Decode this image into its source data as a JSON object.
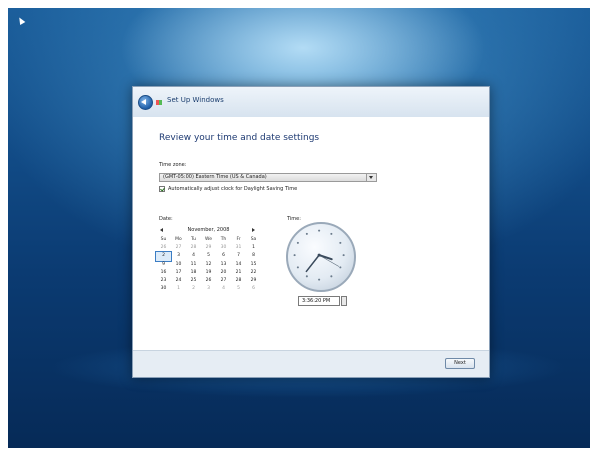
{
  "window": {
    "title": "Set Up Windows"
  },
  "page": {
    "heading": "Review your time and date settings",
    "time_zone_label": "Time zone:",
    "time_zone_value": "(GMT-05:00) Eastern Time (US & Canada)",
    "dst_label": "Automatically adjust clock for Daylight Saving Time",
    "dst_checked": true,
    "date_label": "Date:",
    "time_label": "Time:"
  },
  "calendar": {
    "month_label": "November, 2008",
    "weekdays": [
      "Su",
      "Mo",
      "Tu",
      "We",
      "Th",
      "Fr",
      "Sa"
    ],
    "weeks": [
      [
        "26",
        "27",
        "28",
        "29",
        "30",
        "31",
        "1"
      ],
      [
        "2",
        "3",
        "4",
        "5",
        "6",
        "7",
        "8"
      ],
      [
        "9",
        "10",
        "11",
        "12",
        "13",
        "14",
        "15"
      ],
      [
        "16",
        "17",
        "18",
        "19",
        "20",
        "21",
        "22"
      ],
      [
        "23",
        "24",
        "25",
        "26",
        "27",
        "28",
        "29"
      ],
      [
        "30",
        "1",
        "2",
        "3",
        "4",
        "5",
        "6"
      ]
    ],
    "selected_day": "2"
  },
  "clock": {
    "hour": 3,
    "minute": 36,
    "second": 20,
    "time_text": "3:36:20 PM"
  },
  "footer": {
    "next_label": "Next"
  },
  "colors": {
    "desktop_top": "#1c5f9c",
    "desktop_bottom": "#062a57",
    "heading": "#1e3a72",
    "selection": "#3b7dc4"
  }
}
